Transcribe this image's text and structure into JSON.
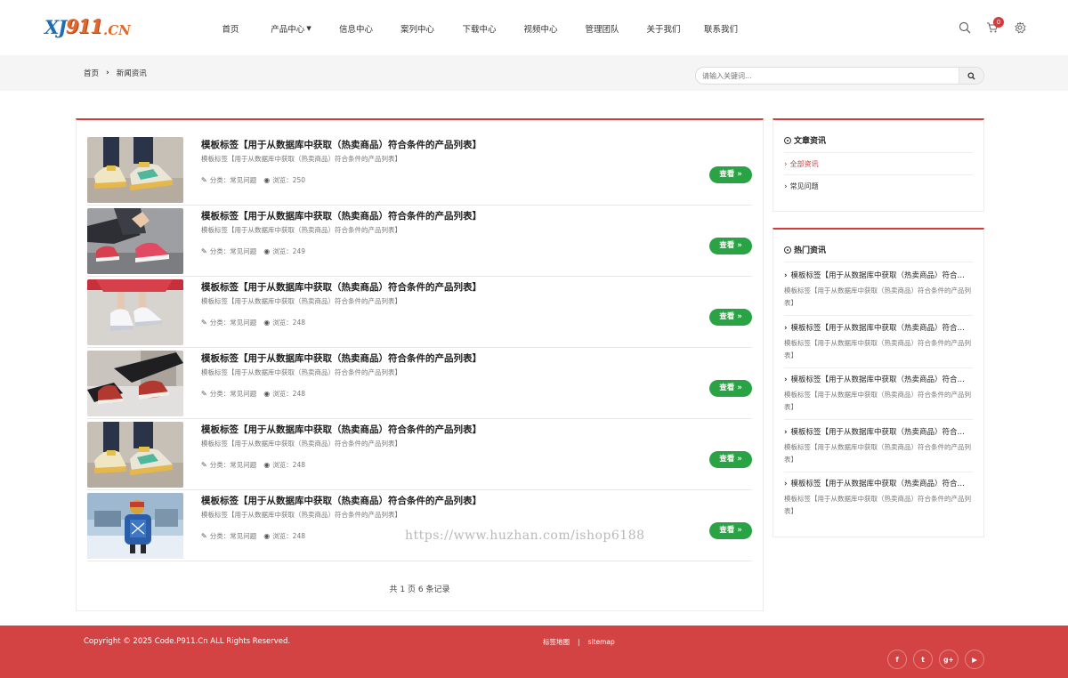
{
  "logo": {
    "part1": "XJ",
    "part2": "911",
    "part3": ".CN"
  },
  "nav": {
    "items": [
      {
        "label": "首页",
        "width": 58
      },
      {
        "label": "产品中心",
        "width": 78,
        "has_caret": true
      },
      {
        "label": "信息中心",
        "width": 68
      },
      {
        "label": "案列中心",
        "width": 70
      },
      {
        "label": "下载中心",
        "width": 69
      },
      {
        "label": "视频中心",
        "width": 69
      },
      {
        "label": "管理团队",
        "width": 69
      },
      {
        "label": "关于我们",
        "width": 69
      },
      {
        "label": "联系我们",
        "width": 60
      }
    ],
    "cart_count": "0"
  },
  "breadcrumb": {
    "home": "首页",
    "current": "新闻资讯"
  },
  "search": {
    "placeholder": "请输入关键词..."
  },
  "articles": [
    {
      "title": "模板标签【用于从数据库中获取（热卖商品）符合条件的产品列表】",
      "summary": "模板标签【用于从数据库中获取（热卖商品）符合条件的产品列表】",
      "category": "分类：常见问题",
      "views": "浏览：250",
      "button": "查看 »",
      "image": "shoe-platform"
    },
    {
      "title": "模板标签【用于从数据库中获取（热卖商品）符合条件的产品列表】",
      "summary": "模板标签【用于从数据库中获取（热卖商品）符合条件的产品列表】",
      "category": "分类：常见问题",
      "views": "浏览：249",
      "button": "查看 »",
      "image": "shoe-pink-lacing"
    },
    {
      "title": "模板标签【用于从数据库中获取（热卖商品）符合条件的产品列表】",
      "summary": "模板标签【用于从数据库中获取（热卖商品）符合条件的产品列表】",
      "category": "分类：常见问题",
      "views": "浏览：248",
      "button": "查看 »",
      "image": "shoe-white-red-dress"
    },
    {
      "title": "模板标签【用于从数据库中获取（热卖商品）符合条件的产品列表】",
      "summary": "模板标签【用于从数据库中获取（热卖商品）符合条件的产品列表】",
      "category": "分类：常见问题",
      "views": "浏览：248",
      "button": "查看 »",
      "image": "shoe-red-sneaker"
    },
    {
      "title": "模板标签【用于从数据库中获取（热卖商品）符合条件的产品列表】",
      "summary": "模板标签【用于从数据库中获取（热卖商品）符合条件的产品列表】",
      "category": "分类：常见问题",
      "views": "浏览：248",
      "button": "查看 »",
      "image": "shoe-platform"
    },
    {
      "title": "模板标签【用于从数据库中获取（热卖商品）符合条件的产品列表】",
      "summary": "模板标签【用于从数据库中获取（热卖商品）符合条件的产品列表】",
      "category": "分类：常见问题",
      "views": "浏览：248",
      "button": "查看 »",
      "image": "child-backpack-snow"
    }
  ],
  "pager": {
    "text": "共 1 页 6 条记录"
  },
  "sidebar": {
    "categories_title": "文章资讯",
    "categories": [
      {
        "label": "全部资讯",
        "active": true
      },
      {
        "label": "常见问题",
        "active": false
      }
    ],
    "hot_title": "热门资讯",
    "hot_items": [
      {
        "title": "模板标签【用于从数据库中获取（热卖商品）符合条件的产品列表】",
        "desc": "模板标签【用于从数据库中获取（热卖商品）符合条件的产品列表】"
      },
      {
        "title": "模板标签【用于从数据库中获取（热卖商品）符合条件的产品列表】",
        "desc": "模板标签【用于从数据库中获取（热卖商品）符合条件的产品列表】"
      },
      {
        "title": "模板标签【用于从数据库中获取（热卖商品）符合条件的产品列表】",
        "desc": "模板标签【用于从数据库中获取（热卖商品）符合条件的产品列表】"
      },
      {
        "title": "模板标签【用于从数据库中获取（热卖商品）符合条件的产品列表】",
        "desc": "模板标签【用于从数据库中获取（热卖商品）符合条件的产品列表】"
      },
      {
        "title": "模板标签【用于从数据库中获取（热卖商品）符合条件的产品列表】",
        "desc": "模板标签【用于从数据库中获取（热卖商品）符合条件的产品列表】"
      }
    ]
  },
  "watermark": "https://www.huzhan.com/ishop6188",
  "footer": {
    "copyright": "Copyright © 2025 Code.P911.Cn ALL Rights Reserved.",
    "link_tags": "标签地图",
    "link_sep": "|",
    "link_sitemap": "sitemap",
    "social": [
      {
        "icon": "facebook-icon",
        "glyph": "f"
      },
      {
        "icon": "twitter-icon",
        "glyph": "t"
      },
      {
        "icon": "google-plus-icon",
        "glyph": "g+"
      },
      {
        "icon": "youtube-icon",
        "glyph": "▶"
      }
    ]
  },
  "colors": {
    "brand_red": "#d63a3a",
    "button_green": "#2aa344",
    "footer_red": "#d44343"
  }
}
